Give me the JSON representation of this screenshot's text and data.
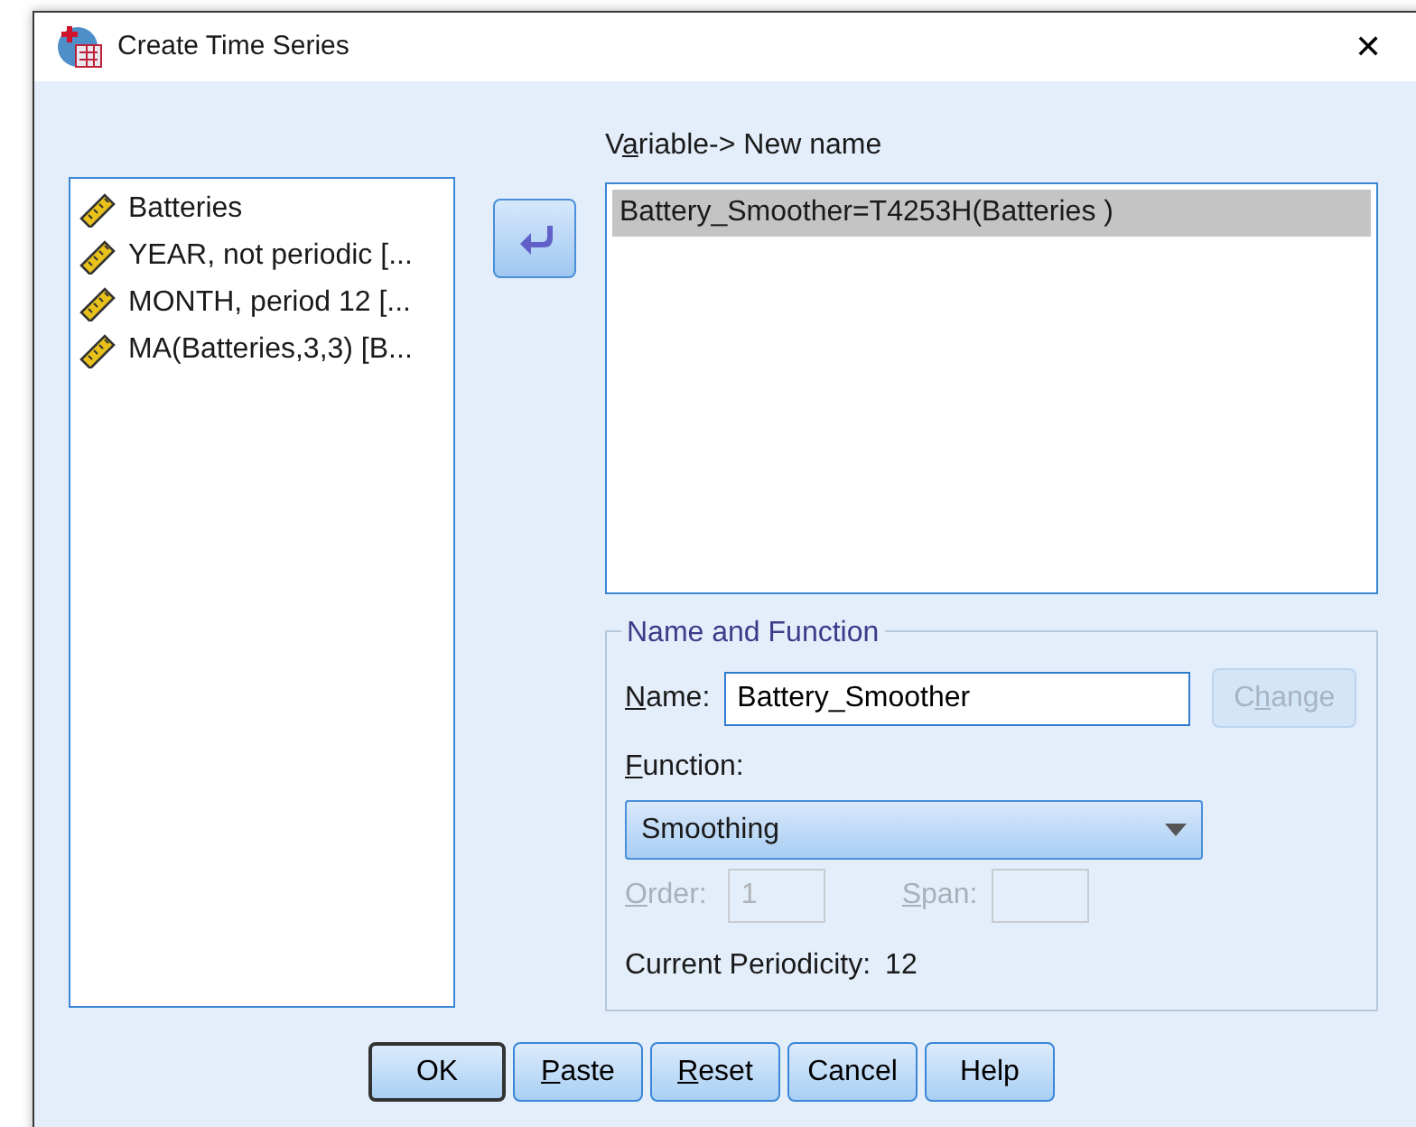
{
  "window": {
    "title": "Create Time Series",
    "close": "✕"
  },
  "source_list": {
    "items": [
      {
        "label": "Batteries",
        "selected": false
      },
      {
        "label": "YEAR, not periodic [...",
        "selected": false
      },
      {
        "label": "MONTH, period 12 [...",
        "selected": false
      },
      {
        "label": "MA(Batteries,3,3) [B...",
        "selected": false
      }
    ]
  },
  "target": {
    "label": [
      {
        "text": "V",
        "underlined": false
      },
      {
        "text": "a",
        "underlined": true
      },
      {
        "text": "riable-> New name",
        "underlined": false
      }
    ],
    "items": [
      {
        "label": "Battery_Smoother=T4253H(Batteries )",
        "selected": true
      }
    ]
  },
  "name_and_function": {
    "title": "Name and Function",
    "name_label": [
      {
        "text": "N",
        "underlined": true
      },
      {
        "text": "ame:",
        "underlined": false
      }
    ],
    "name_value": "Battery_Smoother",
    "change_button": {
      "label": [
        {
          "text": "C",
          "underlined": false
        },
        {
          "text": "h",
          "underlined": true
        },
        {
          "text": "ange",
          "underlined": false
        }
      ],
      "disabled": true
    },
    "function_label": [
      {
        "text": "F",
        "underlined": true
      },
      {
        "text": "unction:",
        "underlined": false
      }
    ],
    "function_value": "Smoothing",
    "order": {
      "label": [
        {
          "text": "O",
          "underlined": true
        },
        {
          "text": "rder:",
          "underlined": false
        }
      ],
      "value": "1",
      "disabled": true
    },
    "span": {
      "label": [
        {
          "text": "S",
          "underlined": true
        },
        {
          "text": "pan:",
          "underlined": false
        }
      ],
      "disabled": true
    },
    "periodicity_label": "Current Periodicity:",
    "periodicity_value": "12"
  },
  "buttons": [
    {
      "label": [
        {
          "text": "OK",
          "underlined": false
        }
      ],
      "default": true
    },
    {
      "label": [
        {
          "text": "P",
          "underlined": true
        },
        {
          "text": "aste",
          "underlined": false
        }
      ],
      "default": false
    },
    {
      "label": [
        {
          "text": "R",
          "underlined": true
        },
        {
          "text": "eset",
          "underlined": false
        }
      ],
      "default": false
    },
    {
      "label": [
        {
          "text": "Cancel",
          "underlined": false
        }
      ],
      "default": false
    },
    {
      "label": [
        {
          "text": "Help",
          "underlined": false
        }
      ],
      "default": false
    }
  ]
}
